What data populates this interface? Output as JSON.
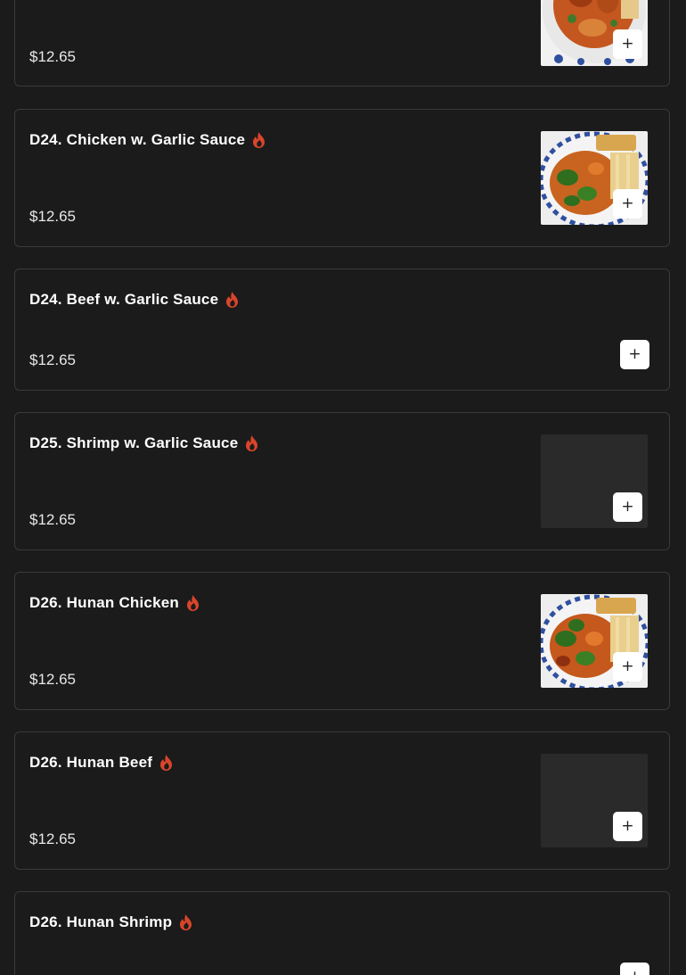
{
  "items": [
    {
      "title": "",
      "price": "$12.65"
    },
    {
      "title": "D24. Chicken w. Garlic Sauce",
      "price": "$12.65"
    },
    {
      "title": "D24. Beef w. Garlic Sauce",
      "price": "$12.65"
    },
    {
      "title": "D25. Shrimp w. Garlic Sauce",
      "price": "$12.65"
    },
    {
      "title": "D26. Hunan Chicken",
      "price": "$12.65"
    },
    {
      "title": "D26. Hunan Beef",
      "price": "$12.65"
    },
    {
      "title": "D26. Hunan Shrimp",
      "price": ""
    }
  ],
  "add_label": "+",
  "icons": {
    "spicy": "flame-icon",
    "add": "plus-icon"
  },
  "colors": {
    "background": "#1b1b1b",
    "card_border": "#3a3a3a",
    "spicy": "#d9452b",
    "placeholder": "#2a2a2a"
  }
}
